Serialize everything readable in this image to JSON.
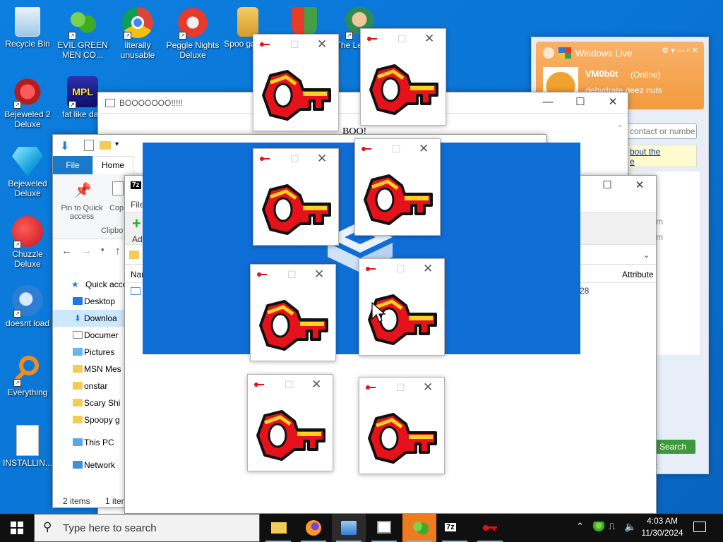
{
  "desktop": {
    "icons": [
      {
        "label": "Recycle Bin",
        "shortcut": false
      },
      {
        "label": "EVIL GREEN MEN CO...",
        "shortcut": true
      },
      {
        "label": "literally unusable",
        "shortcut": true
      },
      {
        "label": "Peggle Nights Deluxe",
        "shortcut": true
      },
      {
        "label": "Spoo games",
        "shortcut": false
      },
      {
        "label": "The Le of Zil",
        "shortcut": true
      },
      {
        "label": "Bejeweled 2 Deluxe",
        "shortcut": true
      },
      {
        "label": "fat like darl",
        "shortcut": true
      },
      {
        "label": "Bejeweled Deluxe",
        "shortcut": true
      },
      {
        "label": "Chuzzle Deluxe",
        "shortcut": true
      },
      {
        "label": "doesnt load",
        "shortcut": true
      },
      {
        "label": "Everything",
        "shortcut": true
      },
      {
        "label": "INSTALLIN...",
        "shortcut": false
      }
    ]
  },
  "boo_window": {
    "title": "BOOOOOOO!!!!!",
    "body_text": "BOO!"
  },
  "explorer": {
    "ribbon_tabs": [
      "File",
      "Home"
    ],
    "pin_label": "Pin to Quick access",
    "copy_label": "Cop",
    "clipboard_label": "Clipbo",
    "quick_access": "Quick acce",
    "nav_items": [
      "Desktop",
      "Downloa",
      "Documer",
      "Pictures",
      "MSN Mes",
      "onstar",
      "Scary Shi",
      "Spoopy g"
    ],
    "this_pc": "This PC",
    "network": "Network",
    "status_left": "2 items",
    "status_right": "1 item"
  },
  "seven_zip": {
    "title_icon": "7z",
    "file_menu": "File",
    "add_label": "Ad",
    "name_header": "Nar",
    "attributes_header": "Attribute",
    "row_value": "28"
  },
  "msn": {
    "title": "Windows Live",
    "username": "VM0b0t",
    "status": "(Online)",
    "personal_message": "dehydrate deez nuts",
    "search_placeholder": "contact or numbe",
    "link_text_1": "bout the",
    "link_text_2": "e",
    "side_text_1": "m",
    "side_text_2": "m",
    "search_button": "Search",
    "bottom_text": "er"
  },
  "installer": {
    "description": "Loading splash with tray/box logo"
  },
  "key_windows_count": 8,
  "taskbar": {
    "search_placeholder": "Type here to search",
    "time": "4:03 AM",
    "date": "11/30/2024",
    "apps": [
      "file-explorer",
      "firefox",
      "installer",
      "window",
      "msn-messenger",
      "7zip-key"
    ]
  },
  "colors": {
    "desktop_blue": "#0a78d7",
    "splash_blue": "#0f6dd6",
    "key_red": "#e5121b",
    "key_yellow": "#ffd21f",
    "msn_orange": "#f59b3c"
  }
}
